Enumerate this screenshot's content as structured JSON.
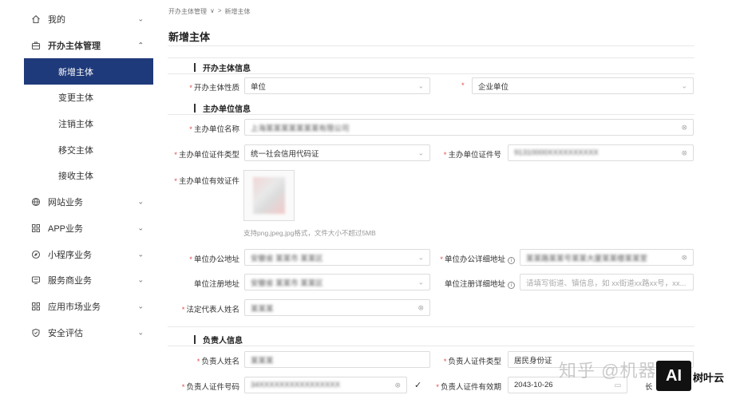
{
  "sidebar": {
    "items": [
      {
        "label": "我的",
        "icon": "home-icon"
      },
      {
        "label": "开办主体管理",
        "icon": "briefcase-icon"
      },
      {
        "label": "网站业务",
        "icon": "globe-icon"
      },
      {
        "label": "APP业务",
        "icon": "grid-icon"
      },
      {
        "label": "小程序业务",
        "icon": "compass-icon"
      },
      {
        "label": "服务商业务",
        "icon": "monitor-icon"
      },
      {
        "label": "应用市场业务",
        "icon": "grid-icon"
      },
      {
        "label": "安全评估",
        "icon": "shield-icon"
      }
    ],
    "subitems": [
      "新增主体",
      "变更主体",
      "注销主体",
      "移交主体",
      "接收主体"
    ],
    "active_sub": "新增主体"
  },
  "breadcrumb": {
    "parent": "开办主体管理",
    "sep": ">",
    "current": "新增主体"
  },
  "page_title": "新增主体",
  "sections": {
    "s1": "开办主体信息",
    "s2": "主办单位信息",
    "s3": "负责人信息"
  },
  "form": {
    "nature": {
      "label": "开办主体性质",
      "value": "单位"
    },
    "nature2": {
      "value": "企业单位"
    },
    "org_name": {
      "label": "主办单位名称",
      "value": "上海某某某某某某某有限公司"
    },
    "cert_type": {
      "label": "主办单位证件类型",
      "value": "统一社会信用代码证"
    },
    "cert_no": {
      "label": "主办单位证件号",
      "value": "91310000XXXXXXXXXX"
    },
    "cert_file": {
      "label": "主办单位有效证件",
      "hint": "支持png,jpeg,jpg格式，文件大小不超过5MB"
    },
    "office_addr": {
      "label": "单位办公地址",
      "value": "安徽省 某某市 某某区"
    },
    "office_detail": {
      "label": "单位办公详细地址",
      "value": "某某路某某号某某大厦某某楼某某室"
    },
    "reg_addr": {
      "label": "单位注册地址",
      "value": "安徽省 某某市 某某区"
    },
    "reg_detail": {
      "label": "单位注册详细地址",
      "placeholder": "请填写街道、镇信息，如 xx街道xx路xx号，xx..."
    },
    "legal_rep": {
      "label": "法定代表人姓名",
      "value": "某某某"
    },
    "person_name": {
      "label": "负责人姓名",
      "value": "某某某"
    },
    "person_cert_type": {
      "label": "负责人证件类型",
      "value": "居民身份证"
    },
    "person_cert_no": {
      "label": "负责人证件号码",
      "value": "34XXXXXXXXXXXXXXXX"
    },
    "person_cert_valid": {
      "label": "负责人证件有效期",
      "value": "2043-10-26",
      "extra": "长"
    }
  },
  "watermark": "知乎 @机器人图",
  "brand": {
    "logo": "AI",
    "text": "树叶云"
  }
}
